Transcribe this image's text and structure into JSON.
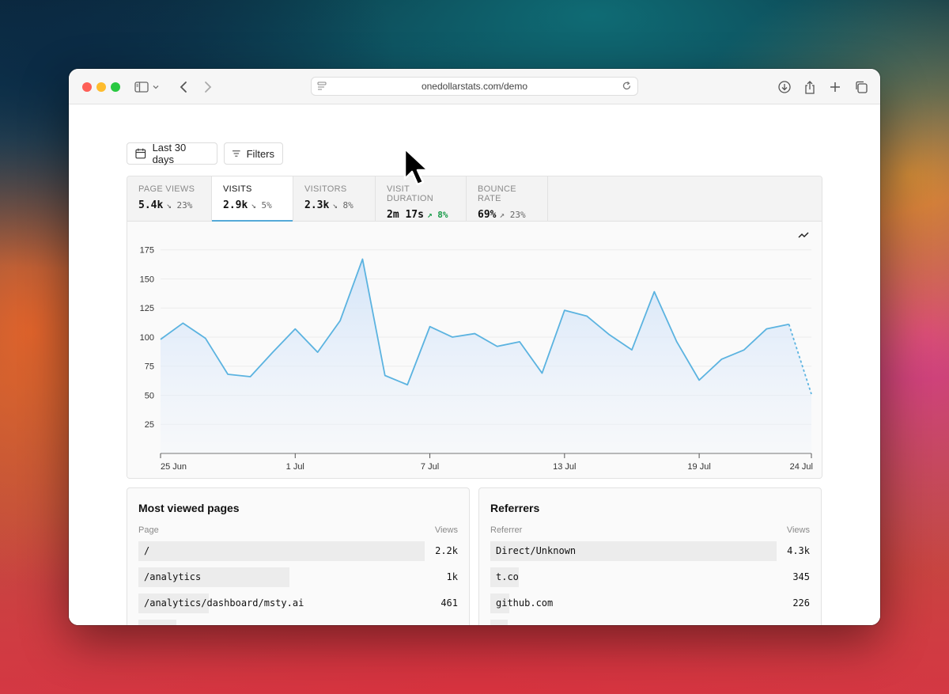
{
  "browser": {
    "url": "onedollarstats.com/demo"
  },
  "toolbar": {
    "date_range_label": "Last 30 days",
    "filters_label": "Filters"
  },
  "metrics": [
    {
      "label": "PAGE VIEWS",
      "value": "5.4k",
      "delta": "↘ 23%",
      "direction": "down",
      "active": false
    },
    {
      "label": "VISITS",
      "value": "2.9k",
      "delta": "↘ 5%",
      "direction": "down",
      "active": true
    },
    {
      "label": "VISITORS",
      "value": "2.3k",
      "delta": "↘ 8%",
      "direction": "down",
      "active": false
    },
    {
      "label": "VISIT DURATION",
      "value": "2m 17s",
      "delta": "↗ 8%",
      "direction": "up",
      "active": false
    },
    {
      "label": "BOUNCE RATE",
      "value": "69%",
      "delta": "↗ 23%",
      "direction": "up",
      "active": false
    }
  ],
  "chart_data": {
    "type": "area",
    "x_ticks": [
      "25 Jun",
      "1 Jul",
      "7 Jul",
      "13 Jul",
      "19 Jul",
      "24 Jul"
    ],
    "y_ticks": [
      25,
      50,
      75,
      100,
      125,
      150,
      175
    ],
    "ylim": [
      0,
      185
    ],
    "x": [
      "25 Jun",
      "26 Jun",
      "27 Jun",
      "28 Jun",
      "29 Jun",
      "30 Jun",
      "1 Jul",
      "2 Jul",
      "3 Jul",
      "4 Jul",
      "5 Jul",
      "6 Jul",
      "7 Jul",
      "8 Jul",
      "9 Jul",
      "10 Jul",
      "11 Jul",
      "12 Jul",
      "13 Jul",
      "14 Jul",
      "15 Jul",
      "16 Jul",
      "17 Jul",
      "18 Jul",
      "19 Jul",
      "20 Jul",
      "21 Jul",
      "22 Jul",
      "23 Jul",
      "24 Jul"
    ],
    "values": [
      98,
      112,
      99,
      68,
      66,
      87,
      107,
      87,
      114,
      167,
      67,
      59,
      109,
      100,
      103,
      92,
      96,
      69,
      123,
      118,
      102,
      89,
      139,
      96,
      63,
      81,
      89,
      107,
      111,
      51
    ],
    "partial_last_point": true,
    "series_color": "#5bb3e0",
    "grid": true
  },
  "most_viewed": {
    "title": "Most viewed pages",
    "col_left": "Page",
    "col_right": "Views",
    "rows": [
      {
        "label": "/",
        "value": "2.2k",
        "fill": 1.0
      },
      {
        "label": "/analytics",
        "value": "1k",
        "fill": 0.53
      },
      {
        "label": "/analytics/dashboard/msty.ai",
        "value": "461",
        "fill": 0.25
      }
    ]
  },
  "referrers": {
    "title": "Referrers",
    "col_left": "Referrer",
    "col_right": "Views",
    "rows": [
      {
        "label": "Direct/Unknown",
        "value": "4.3k",
        "fill": 1.0
      },
      {
        "label": "t.co",
        "value": "345",
        "fill": 0.1
      },
      {
        "label": "github.com",
        "value": "226",
        "fill": 0.06
      }
    ]
  }
}
